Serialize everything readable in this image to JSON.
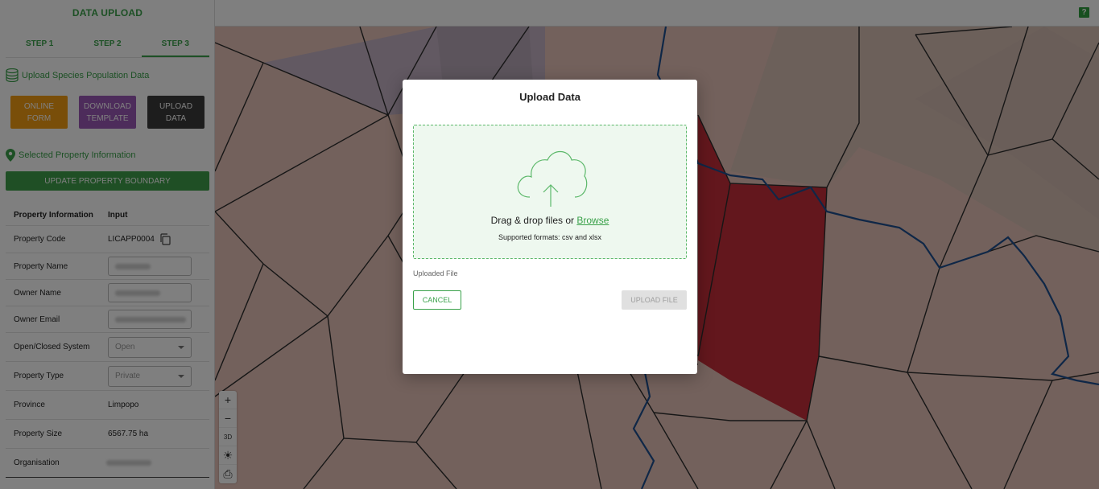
{
  "sidebar": {
    "title": "DATA UPLOAD",
    "steps": [
      "STEP 1",
      "STEP 2",
      "STEP 3"
    ],
    "upload_section": "Upload Species Population Data",
    "buttons": {
      "online_form": [
        "ONLINE",
        "FORM"
      ],
      "download_template": [
        "DOWNLOAD",
        "TEMPLATE"
      ],
      "upload_data": [
        "UPLOAD",
        "DATA"
      ]
    },
    "property_section": "Selected Property Information",
    "update_boundary": "UPDATE PROPERTY BOUNDARY",
    "table": {
      "header_key": "Property Information",
      "header_value": "Input",
      "property_code": {
        "label": "Property Code",
        "value": "LICAPP0004"
      },
      "property_name": {
        "label": "Property Name"
      },
      "owner_name": {
        "label": "Owner Name"
      },
      "owner_email": {
        "label": "Owner Email"
      },
      "open_closed": {
        "label": "Open/Closed System",
        "value": "Open"
      },
      "property_type": {
        "label": "Property Type",
        "value": "Private"
      },
      "province": {
        "label": "Province",
        "value": "Limpopo"
      },
      "property_size": {
        "label": "Property Size",
        "value": "6567.75 ha"
      },
      "organisation": {
        "label": "Organisation"
      }
    }
  },
  "topbar": {
    "help": "?"
  },
  "map_controls": {
    "zoom_in": "+",
    "zoom_out": "−",
    "three_d": "3D"
  },
  "modal": {
    "title": "Upload Data",
    "drop_text": "Drag & drop files or",
    "browse": "Browse",
    "formats": "Supported formats: csv and xlsx",
    "uploaded_label": "Uploaded File",
    "cancel": "CANCEL",
    "upload_file": "UPLOAD FILE"
  },
  "colors": {
    "accent": "#3aa14a",
    "orange": "#f39c12",
    "purple": "#9b59b6",
    "dark": "#3a3a3a",
    "selected_parcel": "#c62f3b",
    "river": "#1f4f8f"
  }
}
